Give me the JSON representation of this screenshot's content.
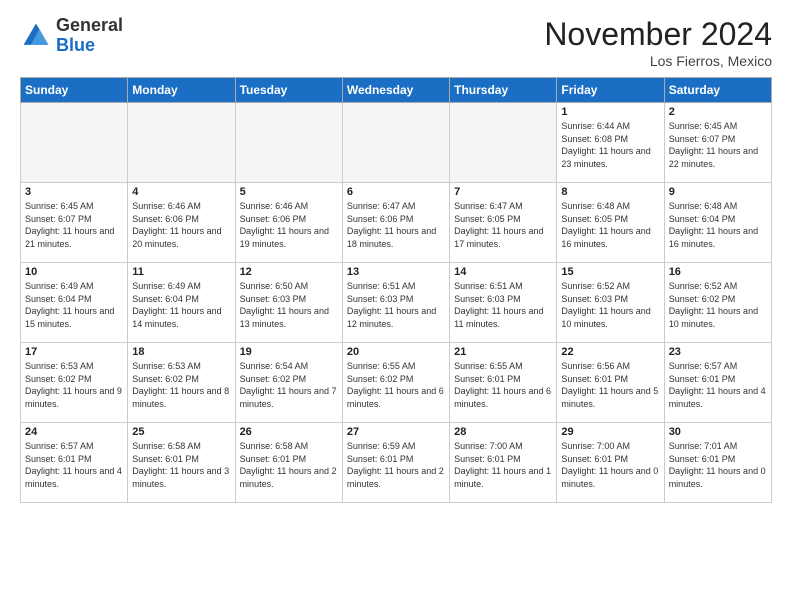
{
  "header": {
    "logo_general": "General",
    "logo_blue": "Blue",
    "month_title": "November 2024",
    "location": "Los Fierros, Mexico"
  },
  "weekdays": [
    "Sunday",
    "Monday",
    "Tuesday",
    "Wednesday",
    "Thursday",
    "Friday",
    "Saturday"
  ],
  "weeks": [
    [
      {
        "day": "",
        "empty": true
      },
      {
        "day": "",
        "empty": true
      },
      {
        "day": "",
        "empty": true
      },
      {
        "day": "",
        "empty": true
      },
      {
        "day": "",
        "empty": true
      },
      {
        "day": "1",
        "sunrise": "Sunrise: 6:44 AM",
        "sunset": "Sunset: 6:08 PM",
        "daylight": "Daylight: 11 hours and 23 minutes."
      },
      {
        "day": "2",
        "sunrise": "Sunrise: 6:45 AM",
        "sunset": "Sunset: 6:07 PM",
        "daylight": "Daylight: 11 hours and 22 minutes."
      }
    ],
    [
      {
        "day": "3",
        "sunrise": "Sunrise: 6:45 AM",
        "sunset": "Sunset: 6:07 PM",
        "daylight": "Daylight: 11 hours and 21 minutes."
      },
      {
        "day": "4",
        "sunrise": "Sunrise: 6:46 AM",
        "sunset": "Sunset: 6:06 PM",
        "daylight": "Daylight: 11 hours and 20 minutes."
      },
      {
        "day": "5",
        "sunrise": "Sunrise: 6:46 AM",
        "sunset": "Sunset: 6:06 PM",
        "daylight": "Daylight: 11 hours and 19 minutes."
      },
      {
        "day": "6",
        "sunrise": "Sunrise: 6:47 AM",
        "sunset": "Sunset: 6:06 PM",
        "daylight": "Daylight: 11 hours and 18 minutes."
      },
      {
        "day": "7",
        "sunrise": "Sunrise: 6:47 AM",
        "sunset": "Sunset: 6:05 PM",
        "daylight": "Daylight: 11 hours and 17 minutes."
      },
      {
        "day": "8",
        "sunrise": "Sunrise: 6:48 AM",
        "sunset": "Sunset: 6:05 PM",
        "daylight": "Daylight: 11 hours and 16 minutes."
      },
      {
        "day": "9",
        "sunrise": "Sunrise: 6:48 AM",
        "sunset": "Sunset: 6:04 PM",
        "daylight": "Daylight: 11 hours and 16 minutes."
      }
    ],
    [
      {
        "day": "10",
        "sunrise": "Sunrise: 6:49 AM",
        "sunset": "Sunset: 6:04 PM",
        "daylight": "Daylight: 11 hours and 15 minutes."
      },
      {
        "day": "11",
        "sunrise": "Sunrise: 6:49 AM",
        "sunset": "Sunset: 6:04 PM",
        "daylight": "Daylight: 11 hours and 14 minutes."
      },
      {
        "day": "12",
        "sunrise": "Sunrise: 6:50 AM",
        "sunset": "Sunset: 6:03 PM",
        "daylight": "Daylight: 11 hours and 13 minutes."
      },
      {
        "day": "13",
        "sunrise": "Sunrise: 6:51 AM",
        "sunset": "Sunset: 6:03 PM",
        "daylight": "Daylight: 11 hours and 12 minutes."
      },
      {
        "day": "14",
        "sunrise": "Sunrise: 6:51 AM",
        "sunset": "Sunset: 6:03 PM",
        "daylight": "Daylight: 11 hours and 11 minutes."
      },
      {
        "day": "15",
        "sunrise": "Sunrise: 6:52 AM",
        "sunset": "Sunset: 6:03 PM",
        "daylight": "Daylight: 11 hours and 10 minutes."
      },
      {
        "day": "16",
        "sunrise": "Sunrise: 6:52 AM",
        "sunset": "Sunset: 6:02 PM",
        "daylight": "Daylight: 11 hours and 10 minutes."
      }
    ],
    [
      {
        "day": "17",
        "sunrise": "Sunrise: 6:53 AM",
        "sunset": "Sunset: 6:02 PM",
        "daylight": "Daylight: 11 hours and 9 minutes."
      },
      {
        "day": "18",
        "sunrise": "Sunrise: 6:53 AM",
        "sunset": "Sunset: 6:02 PM",
        "daylight": "Daylight: 11 hours and 8 minutes."
      },
      {
        "day": "19",
        "sunrise": "Sunrise: 6:54 AM",
        "sunset": "Sunset: 6:02 PM",
        "daylight": "Daylight: 11 hours and 7 minutes."
      },
      {
        "day": "20",
        "sunrise": "Sunrise: 6:55 AM",
        "sunset": "Sunset: 6:02 PM",
        "daylight": "Daylight: 11 hours and 6 minutes."
      },
      {
        "day": "21",
        "sunrise": "Sunrise: 6:55 AM",
        "sunset": "Sunset: 6:01 PM",
        "daylight": "Daylight: 11 hours and 6 minutes."
      },
      {
        "day": "22",
        "sunrise": "Sunrise: 6:56 AM",
        "sunset": "Sunset: 6:01 PM",
        "daylight": "Daylight: 11 hours and 5 minutes."
      },
      {
        "day": "23",
        "sunrise": "Sunrise: 6:57 AM",
        "sunset": "Sunset: 6:01 PM",
        "daylight": "Daylight: 11 hours and 4 minutes."
      }
    ],
    [
      {
        "day": "24",
        "sunrise": "Sunrise: 6:57 AM",
        "sunset": "Sunset: 6:01 PM",
        "daylight": "Daylight: 11 hours and 4 minutes."
      },
      {
        "day": "25",
        "sunrise": "Sunrise: 6:58 AM",
        "sunset": "Sunset: 6:01 PM",
        "daylight": "Daylight: 11 hours and 3 minutes."
      },
      {
        "day": "26",
        "sunrise": "Sunrise: 6:58 AM",
        "sunset": "Sunset: 6:01 PM",
        "daylight": "Daylight: 11 hours and 2 minutes."
      },
      {
        "day": "27",
        "sunrise": "Sunrise: 6:59 AM",
        "sunset": "Sunset: 6:01 PM",
        "daylight": "Daylight: 11 hours and 2 minutes."
      },
      {
        "day": "28",
        "sunrise": "Sunrise: 7:00 AM",
        "sunset": "Sunset: 6:01 PM",
        "daylight": "Daylight: 11 hours and 1 minute."
      },
      {
        "day": "29",
        "sunrise": "Sunrise: 7:00 AM",
        "sunset": "Sunset: 6:01 PM",
        "daylight": "Daylight: 11 hours and 0 minutes."
      },
      {
        "day": "30",
        "sunrise": "Sunrise: 7:01 AM",
        "sunset": "Sunset: 6:01 PM",
        "daylight": "Daylight: 11 hours and 0 minutes."
      }
    ]
  ]
}
